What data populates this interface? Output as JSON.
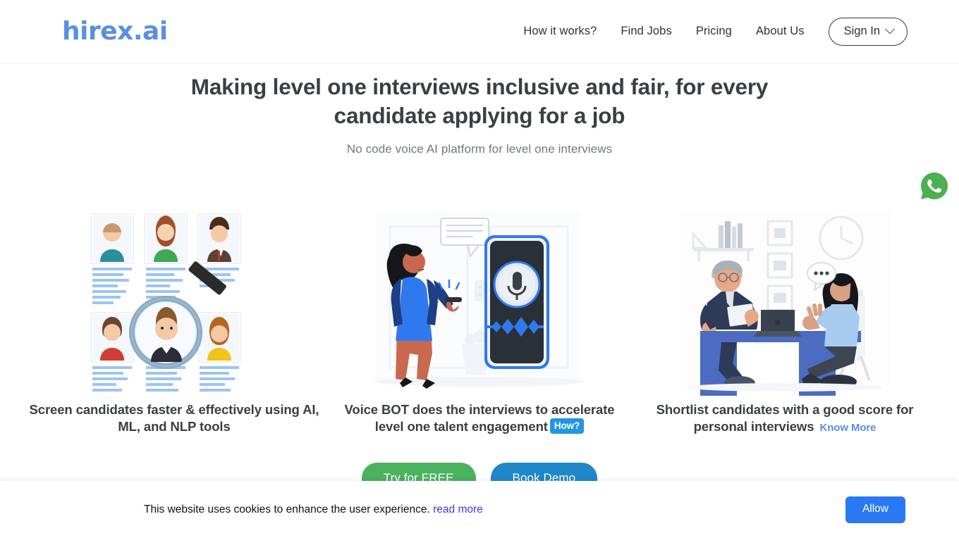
{
  "header": {
    "logo_text": "hirex.ai",
    "nav_items": [
      {
        "label": "How it works?",
        "name": "nav-how-it-works"
      },
      {
        "label": "Find Jobs",
        "name": "nav-find-jobs"
      },
      {
        "label": "Pricing",
        "name": "nav-pricing"
      },
      {
        "label": "About Us",
        "name": "nav-about-us"
      }
    ],
    "signin_label": "Sign In"
  },
  "hero": {
    "title": "Making level one interviews inclusive and fair, for every candidate applying for a job",
    "subtitle": "No code voice AI platform for level one interviews"
  },
  "features": [
    {
      "caption": "Screen candidates faster & effectively using AI, ML, and NLP tools",
      "illustration": "candidate-resume-screening-illustration"
    },
    {
      "caption": "Voice BOT does the interviews to accelerate level one talent engagement",
      "badge": "How?",
      "illustration": "voice-bot-phone-illustration"
    },
    {
      "caption": "Shortlist candidates with a good score for personal interviews",
      "link": "Know More",
      "illustration": "personal-interview-illustration"
    }
  ],
  "cta": {
    "primary_label": "Try for FREE",
    "secondary_label": "Book Demo"
  },
  "cookie_banner": {
    "message": "This website uses cookies to enhance the user experience.",
    "link_label": "read more",
    "allow_label": "Allow"
  },
  "floating": {
    "whatsapp_icon": "whatsapp-icon"
  },
  "colors": {
    "logo_blue": "#5b8fe0",
    "badge_blue": "#2196e3",
    "cta_green": "#4bb25e",
    "cta_blue": "#2088c8",
    "allow_blue": "#2979f2",
    "cookie_link": "#3b38e8",
    "whatsapp_green": "#4caf50",
    "heading_dark": "#3b3e45",
    "subtitle_gray": "#72787f"
  }
}
